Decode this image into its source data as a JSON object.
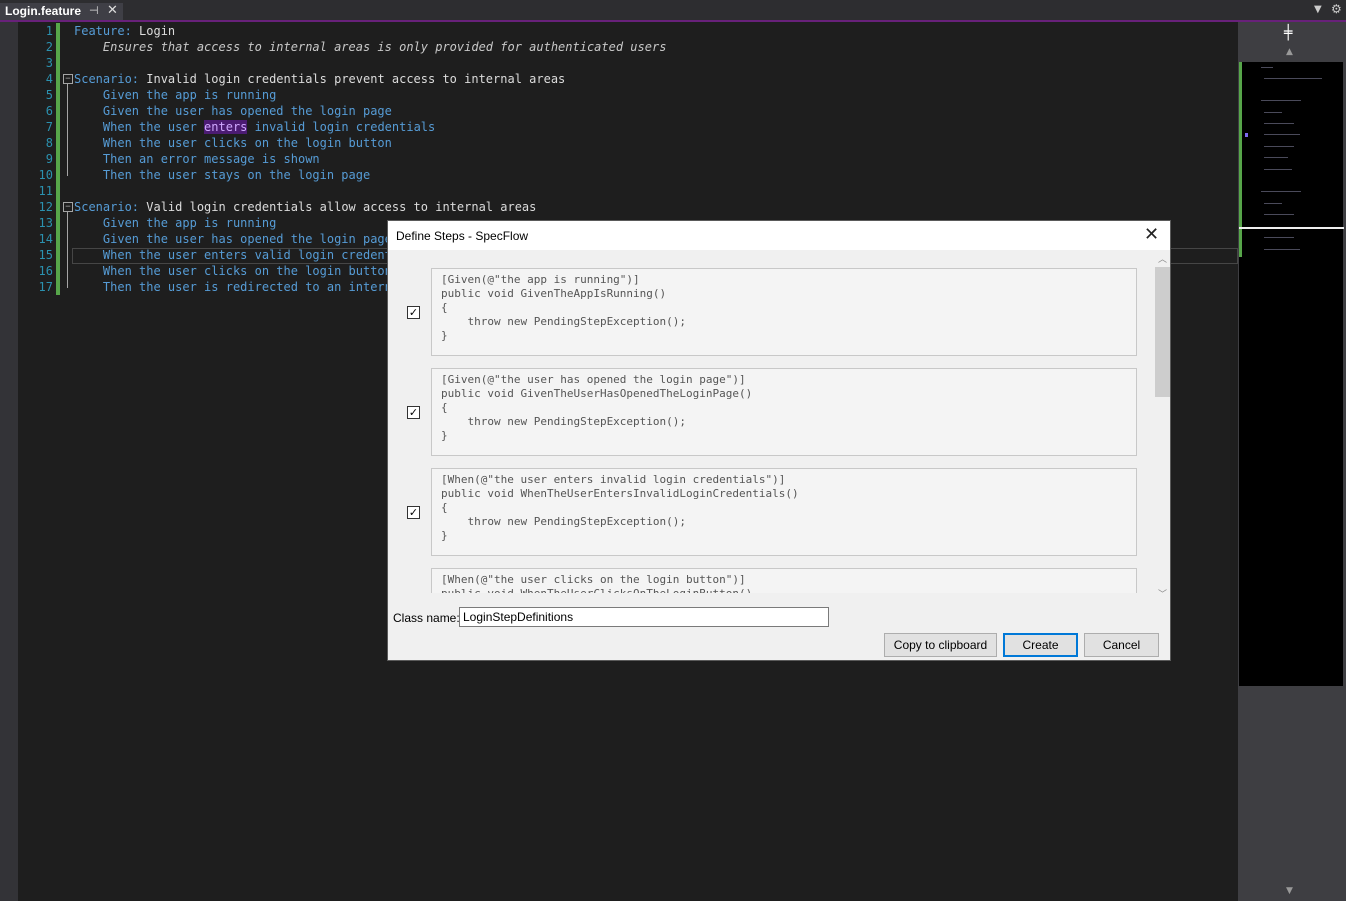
{
  "tab": {
    "title": "Login.feature",
    "pin_glyph": "⊣",
    "close_glyph": "✕",
    "dropdown_glyph": "▼",
    "settings_glyph": "⚙"
  },
  "editor": {
    "lines": [
      {
        "n": "1",
        "parts": [
          {
            "t": "Feature: ",
            "c": "kw"
          },
          {
            "t": "Login",
            "c": "txt"
          }
        ]
      },
      {
        "n": "2",
        "parts": [
          {
            "t": "    Ensures that access to internal areas is only provided for authenticated users",
            "c": "desc"
          }
        ]
      },
      {
        "n": "3",
        "parts": []
      },
      {
        "n": "4",
        "parts": [
          {
            "t": "Scenario: ",
            "c": "kw"
          },
          {
            "t": "Invalid login credentials prevent access to internal areas",
            "c": "txt"
          }
        ]
      },
      {
        "n": "5",
        "parts": [
          {
            "t": "    Given the app is running",
            "c": "kw"
          }
        ]
      },
      {
        "n": "6",
        "parts": [
          {
            "t": "    Given the user has opened the login page",
            "c": "kw"
          }
        ]
      },
      {
        "n": "7",
        "parts": [
          {
            "t": "    When the user ",
            "c": "kw"
          },
          {
            "t": "enters",
            "c": "hl"
          },
          {
            "t": " invalid login credentials",
            "c": "kw"
          }
        ]
      },
      {
        "n": "8",
        "parts": [
          {
            "t": "    When the user clicks on the login button",
            "c": "kw"
          }
        ]
      },
      {
        "n": "9",
        "parts": [
          {
            "t": "    Then an error message is shown",
            "c": "kw"
          }
        ]
      },
      {
        "n": "10",
        "parts": [
          {
            "t": "    Then the user stays on the login page",
            "c": "kw"
          }
        ]
      },
      {
        "n": "11",
        "parts": []
      },
      {
        "n": "12",
        "parts": [
          {
            "t": "Scenario: ",
            "c": "kw"
          },
          {
            "t": "Valid login credentials allow access to internal areas",
            "c": "txt"
          }
        ]
      },
      {
        "n": "13",
        "parts": [
          {
            "t": "    Given the app is running",
            "c": "kw"
          }
        ]
      },
      {
        "n": "14",
        "parts": [
          {
            "t": "    Given the user has opened the login page",
            "c": "kw"
          }
        ]
      },
      {
        "n": "15",
        "parts": [
          {
            "t": "    When the user enters valid login credentials",
            "c": "kw"
          }
        ]
      },
      {
        "n": "16",
        "parts": [
          {
            "t": "    When the user clicks on the login button",
            "c": "kw"
          }
        ]
      },
      {
        "n": "17",
        "parts": [
          {
            "t": "    Then the user is redirected to an internal area",
            "c": "kw"
          }
        ]
      }
    ],
    "fold_glyph": "−"
  },
  "scroll_map": {
    "split_glyph": "╪",
    "up_glyph": "▲",
    "down_glyph": "▼"
  },
  "dialog": {
    "title": "Define Steps - SpecFlow",
    "close_glyph": "✕",
    "check_glyph": "✓",
    "steps": [
      {
        "checked": true,
        "code": "[Given(@\"the app is running\")]\npublic void GivenTheAppIsRunning()\n{\n    throw new PendingStepException();\n}"
      },
      {
        "checked": true,
        "code": "[Given(@\"the user has opened the login page\")]\npublic void GivenTheUserHasOpenedTheLoginPage()\n{\n    throw new PendingStepException();\n}"
      },
      {
        "checked": true,
        "code": "[When(@\"the user enters invalid login credentials\")]\npublic void WhenTheUserEntersInvalidLoginCredentials()\n{\n    throw new PendingStepException();\n}"
      },
      {
        "checked": true,
        "code": "[When(@\"the user clicks on the login button\")]\npublic void WhenTheUserClicksOnTheLoginButton()\n{\n    throw new PendingStepException();\n}"
      }
    ],
    "scroll_up_glyph": "︿",
    "scroll_down_glyph": "﹀",
    "class_name_label": "Class name:",
    "class_name_value": "LoginStepDefinitions",
    "buttons": {
      "copy": "Copy to clipboard",
      "create": "Create",
      "cancel": "Cancel"
    }
  },
  "colors": {
    "keyword": "#569cd6",
    "accent": "#68217a",
    "changed": "#57a64a",
    "highlight": "#4b1b72"
  }
}
